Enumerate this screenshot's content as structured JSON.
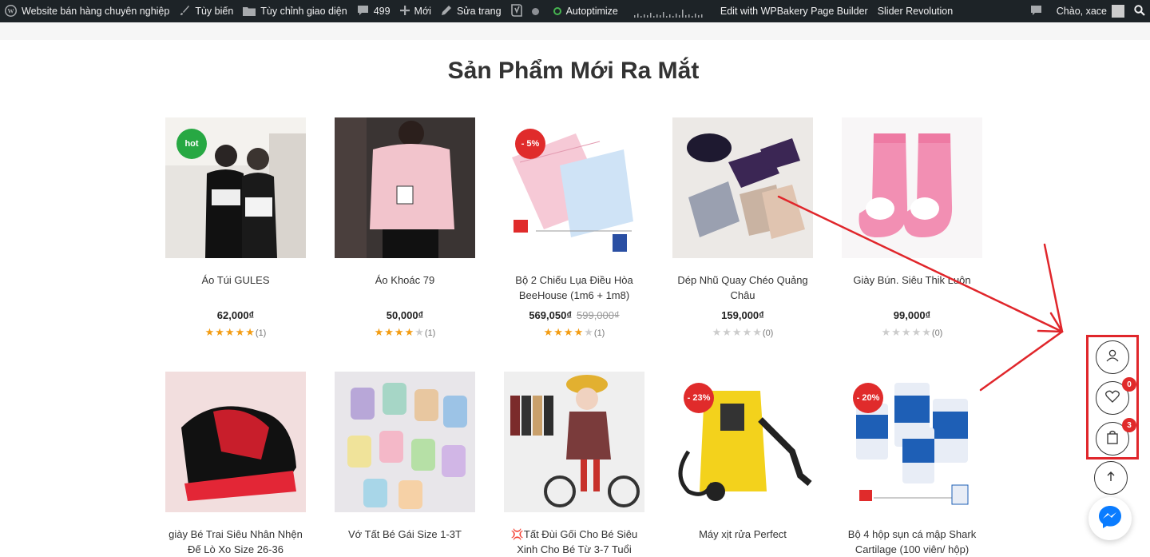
{
  "admin_bar": {
    "site_name": "Website bán hàng chuyên nghiệp",
    "customize": "Tùy biến",
    "customize_theme": "Tùy chỉnh giao diện",
    "comments_count": "499",
    "new": "Mới",
    "edit_page": "Sửa trang",
    "autoptimize": "Autoptimize",
    "wpbakery": "Edit with WPBakery Page Builder",
    "slider_revolution": "Slider Revolution",
    "greeting": "Chào, xace"
  },
  "section": {
    "title": "Sản Phẩm Mới Ra Mắt"
  },
  "products": [
    {
      "name": "Áo Túi GULES",
      "price": "62,000₫",
      "old_price": "",
      "badge": "hot",
      "stars": 5,
      "rating_count": "(1)"
    },
    {
      "name": "Áo Khoác 79",
      "price": "50,000₫",
      "old_price": "",
      "badge": "",
      "stars": 4,
      "rating_count": "(1)"
    },
    {
      "name": "Bộ 2 Chiếu Lụa Điều Hòa BeeHouse (1m6 + 1m8)",
      "price": "569,050₫",
      "old_price": "599,000₫",
      "badge": "- 5%",
      "stars": 4,
      "rating_count": "(1)"
    },
    {
      "name": "Dép Nhũ Quay Chéo Quảng Châu",
      "price": "159,000₫",
      "old_price": "",
      "badge": "",
      "stars": 0,
      "rating_count": "(0)"
    },
    {
      "name": "Giày Bún. Siêu Thik Luôn",
      "price": "99,000₫",
      "old_price": "",
      "badge": "",
      "stars": 0,
      "rating_count": "(0)"
    },
    {
      "name": "giày Bé Trai Siêu Nhân Nhện Đế Lò Xo Size 26-36",
      "badge": ""
    },
    {
      "name": "Vớ Tất Bé Gái Size 1-3T",
      "badge": ""
    },
    {
      "name": "💢Tất Đùi Gối Cho Bé Siêu Xinh Cho Bé Từ 3-7 Tuổi",
      "badge": ""
    },
    {
      "name": "Máy xịt rửa Perfect",
      "badge": "- 23%"
    },
    {
      "name": "Bộ 4 hộp sụn cá mập Shark Cartilage (100 viên/ hộp)",
      "badge": "- 20%"
    }
  ],
  "sticky": {
    "wishlist_count": "0",
    "cart_count": "3"
  },
  "colors": {
    "admin_bar": "#1d2327",
    "sale_badge": "#e02b2b",
    "hot_badge": "#27a843",
    "annotation": "#e0262b",
    "star": "#f39c12"
  },
  "icons": [
    "wordpress-icon",
    "brush-icon",
    "folder-icon",
    "comment-icon",
    "plus-icon",
    "pencil-icon",
    "yoast-icon",
    "user-icon",
    "heart-icon",
    "bag-icon",
    "arrow-up-icon",
    "messenger-icon"
  ]
}
